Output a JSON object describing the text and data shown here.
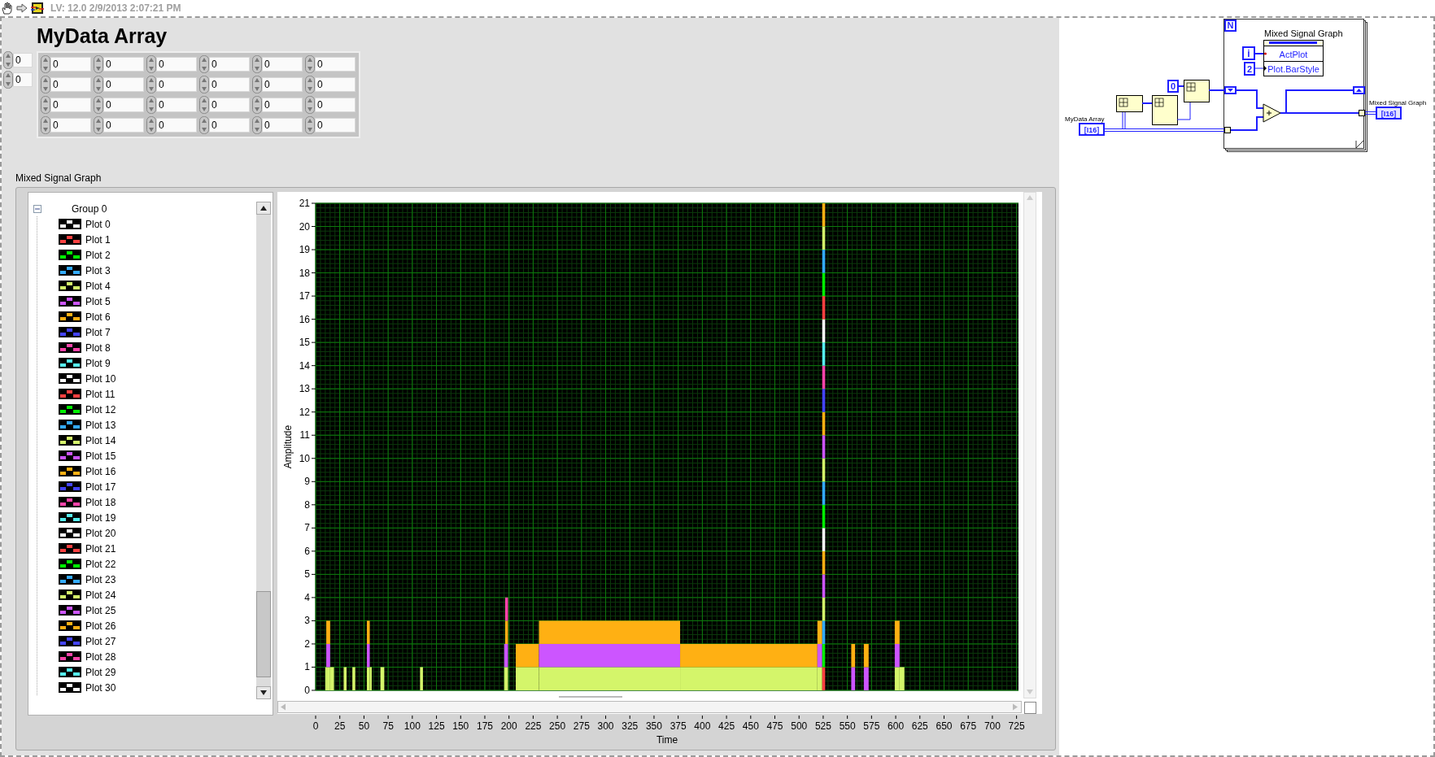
{
  "toolbar": {
    "version_text": "LV: 12.0 2/9/2013 2:07:21 PM"
  },
  "array": {
    "label": "MyData Array",
    "indices": [
      "0",
      "0"
    ],
    "rows": [
      [
        "0",
        "0",
        "0",
        "0",
        "0",
        "0"
      ],
      [
        "0",
        "0",
        "0",
        "0",
        "0",
        "0"
      ],
      [
        "0",
        "0",
        "0",
        "0",
        "0",
        "0"
      ],
      [
        "0",
        "0",
        "0",
        "0",
        "0",
        "0"
      ]
    ]
  },
  "graph": {
    "label": "Mixed Signal Graph",
    "legend": {
      "group": "Group 0",
      "expanded": true,
      "plots": [
        {
          "name": "Plot 0",
          "color": "#ffffff"
        },
        {
          "name": "Plot 1",
          "color": "#ff4040"
        },
        {
          "name": "Plot 2",
          "color": "#00ee00"
        },
        {
          "name": "Plot 3",
          "color": "#33aaff"
        },
        {
          "name": "Plot 4",
          "color": "#d4f56a"
        },
        {
          "name": "Plot 5",
          "color": "#cc55ff"
        },
        {
          "name": "Plot 6",
          "color": "#ffb013"
        },
        {
          "name": "Plot 7",
          "color": "#4444ff"
        },
        {
          "name": "Plot 8",
          "color": "#ff44aa"
        },
        {
          "name": "Plot 9",
          "color": "#55eeee"
        },
        {
          "name": "Plot 10",
          "color": "#ffffff"
        },
        {
          "name": "Plot 11",
          "color": "#ff4040"
        },
        {
          "name": "Plot 12",
          "color": "#00ee00"
        },
        {
          "name": "Plot 13",
          "color": "#33aaff"
        },
        {
          "name": "Plot 14",
          "color": "#d4f56a"
        },
        {
          "name": "Plot 15",
          "color": "#cc55ff"
        },
        {
          "name": "Plot 16",
          "color": "#ffb013"
        },
        {
          "name": "Plot 17",
          "color": "#4444ff"
        },
        {
          "name": "Plot 18",
          "color": "#ff44aa"
        },
        {
          "name": "Plot 19",
          "color": "#55eeee"
        },
        {
          "name": "Plot 20",
          "color": "#ffffff"
        },
        {
          "name": "Plot 21",
          "color": "#ff4040"
        },
        {
          "name": "Plot 22",
          "color": "#00ee00"
        },
        {
          "name": "Plot 23",
          "color": "#33aaff"
        },
        {
          "name": "Plot 24",
          "color": "#d4f56a"
        },
        {
          "name": "Plot 25",
          "color": "#cc55ff"
        },
        {
          "name": "Plot 26",
          "color": "#ffb013"
        },
        {
          "name": "Plot 27",
          "color": "#4444ff"
        },
        {
          "name": "Plot 28",
          "color": "#ff44aa"
        },
        {
          "name": "Plot 29",
          "color": "#55eeee"
        },
        {
          "name": "Plot 30",
          "color": "#ffffff"
        }
      ]
    },
    "chart_data": {
      "type": "bar",
      "stacked": true,
      "xlabel": "Time",
      "ylabel": "Amplitude",
      "xlim": [
        0,
        727
      ],
      "ylim": [
        0,
        21
      ],
      "xticks": [
        0,
        25,
        50,
        75,
        100,
        125,
        150,
        175,
        200,
        225,
        250,
        275,
        300,
        325,
        350,
        375,
        400,
        425,
        450,
        475,
        500,
        525,
        550,
        575,
        600,
        625,
        650,
        675,
        700,
        725
      ],
      "yticks": [
        0,
        1,
        2,
        3,
        4,
        5,
        6,
        7,
        8,
        9,
        10,
        11,
        12,
        13,
        14,
        15,
        16,
        17,
        18,
        19,
        20,
        21
      ],
      "grid": true,
      "x": [
        5,
        10.5,
        13,
        17,
        24,
        30.5,
        35,
        39.5,
        47,
        54.5,
        57,
        62.5,
        69,
        89.5,
        109.5,
        153,
        195.5,
        197.5,
        203,
        219,
        304,
        448,
        521.5,
        525.5,
        540.5,
        556,
        562.5,
        569.5,
        585.5,
        601.5,
        606.5,
        668
      ],
      "series": [
        {
          "color": "#d4f56a",
          "values": [
            0,
            1,
            1,
            1,
            0,
            1,
            0,
            1,
            0,
            1,
            1,
            0,
            1,
            0,
            1,
            0,
            1,
            1,
            0,
            1,
            1,
            1,
            1,
            0,
            0,
            0,
            0,
            0,
            0,
            1,
            1,
            0
          ]
        },
        {
          "color": "#cc55ff",
          "values": [
            0,
            0,
            1,
            0,
            0,
            0,
            0,
            0,
            0,
            1,
            0,
            0,
            0,
            0,
            0,
            0,
            1,
            1,
            0,
            0,
            1,
            0,
            1,
            0,
            0,
            1,
            0,
            1,
            0,
            1,
            0,
            0
          ]
        },
        {
          "color": "#ffb013",
          "values": [
            0,
            0,
            1,
            0,
            0,
            0,
            0,
            0,
            0,
            1,
            0,
            0,
            0,
            0,
            0,
            0,
            0,
            1,
            0,
            1,
            1,
            1,
            1,
            0,
            0,
            1,
            0,
            1,
            0,
            1,
            0,
            0
          ]
        },
        {
          "color": "#ff44aa",
          "values": [
            0,
            0,
            0,
            0,
            0,
            0,
            0,
            0,
            0,
            0,
            0,
            0,
            0,
            0,
            0,
            0,
            0,
            1,
            0,
            0,
            0,
            0,
            0,
            0,
            0,
            0,
            0,
            0,
            0,
            0,
            0,
            0
          ]
        },
        {
          "color": "#ff4040",
          "values": [
            0,
            0,
            0,
            0,
            0,
            0,
            0,
            0,
            0,
            0,
            0,
            0,
            0,
            0,
            0,
            0,
            0,
            0,
            0,
            0,
            0,
            0,
            0,
            1,
            0,
            0,
            0,
            0,
            0,
            0,
            0,
            0
          ]
        },
        {
          "color": "#00ee00",
          "values": [
            0,
            0,
            0,
            0,
            0,
            0,
            0,
            0,
            0,
            0,
            0,
            0,
            0,
            0,
            0,
            0,
            0,
            0,
            0,
            0,
            0,
            0,
            0,
            1,
            0,
            0,
            0,
            0,
            0,
            0,
            0,
            0
          ]
        },
        {
          "color": "#33aaff",
          "values": [
            0,
            0,
            0,
            0,
            0,
            0,
            0,
            0,
            0,
            0,
            0,
            0,
            0,
            0,
            0,
            0,
            0,
            0,
            0,
            0,
            0,
            0,
            0,
            1,
            0,
            0,
            0,
            0,
            0,
            0,
            0,
            0
          ]
        },
        {
          "color": "#d4f56a",
          "values": [
            0,
            0,
            0,
            0,
            0,
            0,
            0,
            0,
            0,
            0,
            0,
            0,
            0,
            0,
            0,
            0,
            0,
            0,
            0,
            0,
            0,
            0,
            0,
            1,
            0,
            0,
            0,
            0,
            0,
            0,
            0,
            0
          ]
        },
        {
          "color": "#cc55ff",
          "values": [
            0,
            0,
            0,
            0,
            0,
            0,
            0,
            0,
            0,
            0,
            0,
            0,
            0,
            0,
            0,
            0,
            0,
            0,
            0,
            0,
            0,
            0,
            0,
            1,
            0,
            0,
            0,
            0,
            0,
            0,
            0,
            0
          ]
        },
        {
          "color": "#ffb013",
          "values": [
            0,
            0,
            0,
            0,
            0,
            0,
            0,
            0,
            0,
            0,
            0,
            0,
            0,
            0,
            0,
            0,
            0,
            0,
            0,
            0,
            0,
            0,
            0,
            1,
            0,
            0,
            0,
            0,
            0,
            0,
            0,
            0
          ]
        },
        {
          "color": "#ffffff",
          "values": [
            0,
            0,
            0,
            0,
            0,
            0,
            0,
            0,
            0,
            0,
            0,
            0,
            0,
            0,
            0,
            0,
            0,
            0,
            0,
            0,
            0,
            0,
            0,
            1,
            0,
            0,
            0,
            0,
            0,
            0,
            0,
            0
          ]
        },
        {
          "color": "#00ee00",
          "values": [
            0,
            0,
            0,
            0,
            0,
            0,
            0,
            0,
            0,
            0,
            0,
            0,
            0,
            0,
            0,
            0,
            0,
            0,
            0,
            0,
            0,
            0,
            0,
            1,
            0,
            0,
            0,
            0,
            0,
            0,
            0,
            0
          ]
        },
        {
          "color": "#33aaff",
          "values": [
            0,
            0,
            0,
            0,
            0,
            0,
            0,
            0,
            0,
            0,
            0,
            0,
            0,
            0,
            0,
            0,
            0,
            0,
            0,
            0,
            0,
            0,
            0,
            1,
            0,
            0,
            0,
            0,
            0,
            0,
            0,
            0
          ]
        },
        {
          "color": "#d4f56a",
          "values": [
            0,
            0,
            0,
            0,
            0,
            0,
            0,
            0,
            0,
            0,
            0,
            0,
            0,
            0,
            0,
            0,
            0,
            0,
            0,
            0,
            0,
            0,
            0,
            1,
            0,
            0,
            0,
            0,
            0,
            0,
            0,
            0
          ]
        },
        {
          "color": "#cc55ff",
          "values": [
            0,
            0,
            0,
            0,
            0,
            0,
            0,
            0,
            0,
            0,
            0,
            0,
            0,
            0,
            0,
            0,
            0,
            0,
            0,
            0,
            0,
            0,
            0,
            1,
            0,
            0,
            0,
            0,
            0,
            0,
            0,
            0
          ]
        },
        {
          "color": "#ffb013",
          "values": [
            0,
            0,
            0,
            0,
            0,
            0,
            0,
            0,
            0,
            0,
            0,
            0,
            0,
            0,
            0,
            0,
            0,
            0,
            0,
            0,
            0,
            0,
            0,
            1,
            0,
            0,
            0,
            0,
            0,
            0,
            0,
            0
          ]
        },
        {
          "color": "#4444ff",
          "values": [
            0,
            0,
            0,
            0,
            0,
            0,
            0,
            0,
            0,
            0,
            0,
            0,
            0,
            0,
            0,
            0,
            0,
            0,
            0,
            0,
            0,
            0,
            0,
            1,
            0,
            0,
            0,
            0,
            0,
            0,
            0,
            0
          ]
        },
        {
          "color": "#ff44aa",
          "values": [
            0,
            0,
            0,
            0,
            0,
            0,
            0,
            0,
            0,
            0,
            0,
            0,
            0,
            0,
            0,
            0,
            0,
            0,
            0,
            0,
            0,
            0,
            0,
            1,
            0,
            0,
            0,
            0,
            0,
            0,
            0,
            0
          ]
        },
        {
          "color": "#55eeee",
          "values": [
            0,
            0,
            0,
            0,
            0,
            0,
            0,
            0,
            0,
            0,
            0,
            0,
            0,
            0,
            0,
            0,
            0,
            0,
            0,
            0,
            0,
            0,
            0,
            1,
            0,
            0,
            0,
            0,
            0,
            0,
            0,
            0
          ]
        },
        {
          "color": "#ffffff",
          "values": [
            0,
            0,
            0,
            0,
            0,
            0,
            0,
            0,
            0,
            0,
            0,
            0,
            0,
            0,
            0,
            0,
            0,
            0,
            0,
            0,
            0,
            0,
            0,
            1,
            0,
            0,
            0,
            0,
            0,
            0,
            0,
            0
          ]
        },
        {
          "color": "#ff4040",
          "values": [
            0,
            0,
            0,
            0,
            0,
            0,
            0,
            0,
            0,
            0,
            0,
            0,
            0,
            0,
            0,
            0,
            0,
            0,
            0,
            0,
            0,
            0,
            0,
            1,
            0,
            0,
            0,
            0,
            0,
            0,
            0,
            0
          ]
        },
        {
          "color": "#00ee00",
          "values": [
            0,
            0,
            0,
            0,
            0,
            0,
            0,
            0,
            0,
            0,
            0,
            0,
            0,
            0,
            0,
            0,
            0,
            0,
            0,
            0,
            0,
            0,
            0,
            1,
            0,
            0,
            0,
            0,
            0,
            0,
            0,
            0
          ]
        },
        {
          "color": "#33aaff",
          "values": [
            0,
            0,
            0,
            0,
            0,
            0,
            0,
            0,
            0,
            0,
            0,
            0,
            0,
            0,
            0,
            0,
            0,
            0,
            0,
            0,
            0,
            0,
            0,
            1,
            0,
            0,
            0,
            0,
            0,
            0,
            0,
            0
          ]
        },
        {
          "color": "#d4f56a",
          "values": [
            0,
            0,
            0,
            0,
            0,
            0,
            0,
            0,
            0,
            0,
            0,
            0,
            0,
            0,
            0,
            0,
            0,
            0,
            0,
            0,
            0,
            0,
            0,
            1,
            0,
            0,
            0,
            0,
            0,
            0,
            0,
            0
          ]
        },
        {
          "color": "#ffb013",
          "values": [
            0,
            0,
            0,
            0,
            0,
            0,
            0,
            0,
            0,
            0,
            0,
            0,
            0,
            0,
            0,
            0,
            0,
            0,
            0,
            0,
            0,
            0,
            0,
            1,
            0,
            0,
            0,
            0,
            0,
            0,
            0,
            0
          ]
        }
      ]
    }
  },
  "block_diagram": {
    "loop_count": "N",
    "loop_index": "i",
    "node_title": "Mixed Signal Graph",
    "properties": [
      "ActPlot",
      "Plot.BarStyle"
    ],
    "bar_style_constant": "2",
    "zero_constant": "0",
    "input_label": "MyData Array",
    "input_terminal": "[I16]",
    "output_label": "Mixed Signal Graph",
    "output_terminal": "[I16]"
  }
}
